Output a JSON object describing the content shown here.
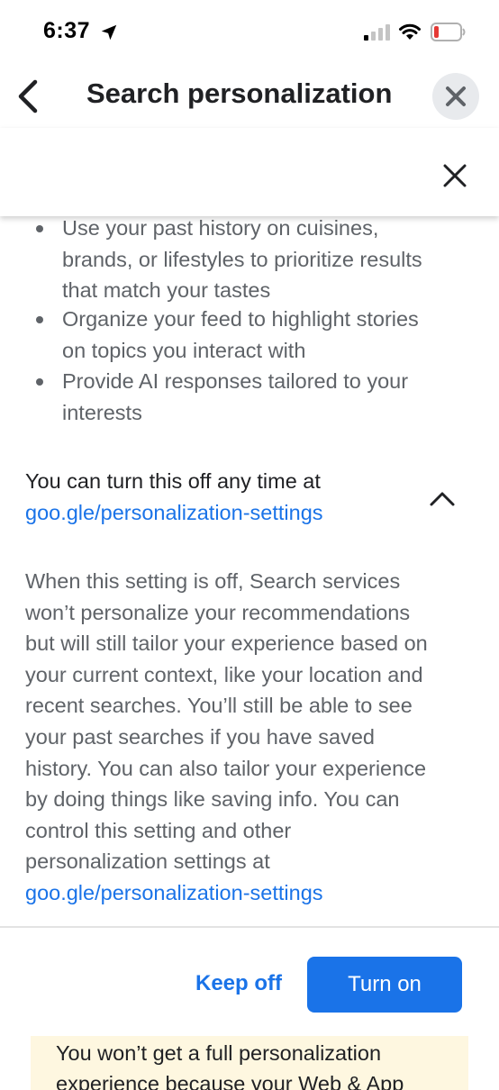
{
  "status_bar": {
    "time": "6:37",
    "icons": [
      "location-arrow-icon",
      "cellular-signal-icon",
      "wifi-icon",
      "battery-low-icon"
    ],
    "battery_color": "#e53935"
  },
  "header": {
    "title": "Search personalization",
    "back_icon": "chevron-left-icon",
    "close_icon": "close-icon"
  },
  "sheet": {
    "close_icon": "close-icon",
    "bullets": [
      {
        "lines": [
          "Use your past history on cuisines,",
          "brands, or lifestyles to prioritize results",
          "that match your tastes"
        ]
      },
      {
        "lines": [
          "Organize your feed to highlight stories",
          "on topics you interact with"
        ]
      },
      {
        "lines": [
          "Provide AI responses tailored to your",
          "interests"
        ]
      }
    ],
    "turnoff_text": "You can turn this off any time at",
    "turnoff_link": "goo.gle/personalization-settings",
    "collapse_icon": "chevron-up-icon",
    "description_lines": [
      "When this setting is off, Search services",
      "won’t personalize your recommendations",
      "but will still tailor your experience based on",
      "your current context, like your location and",
      "recent searches. You’ll still be able to see",
      "your past searches if you have saved",
      "history. You can also tailor your experience",
      "by doing things like saving info. You can",
      "control this setting and other",
      "personalization settings at"
    ],
    "description_link": "goo.gle/personalization-settings"
  },
  "actions": {
    "keep_off_label": "Keep off",
    "turn_on_label": "Turn on"
  },
  "notice": {
    "lines": [
      "You won’t get a full personalization",
      "experience because your Web & App"
    ]
  },
  "colors": {
    "accent": "#1a73e8",
    "notice_bg": "#fef7e0",
    "body_text": "#5f6368",
    "title_text": "#202124"
  }
}
